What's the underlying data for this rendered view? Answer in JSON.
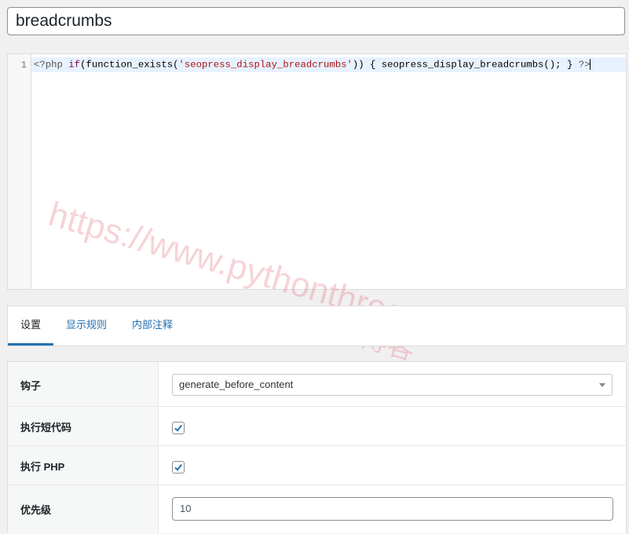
{
  "title_value": "breadcrumbs",
  "editor": {
    "line_number": "1",
    "code": {
      "open_tag": "<?php",
      "kw_if": "if",
      "fn_exists": "(function_exists(",
      "string": "'seopress_display_breadcrumbs'",
      "after_string": ")) { seopress_display_breadcrumbs(); }",
      "close_tag": "?>"
    }
  },
  "watermark": {
    "url": "https://www.pythonthree.com",
    "name": "晓得博客"
  },
  "tabs": [
    {
      "label": "设置",
      "active": true
    },
    {
      "label": "显示规则",
      "active": false
    },
    {
      "label": "内部注释",
      "active": false
    }
  ],
  "settings": {
    "hook": {
      "label": "钩子",
      "value": "generate_before_content"
    },
    "shortcode": {
      "label": "执行短代码",
      "checked": true
    },
    "php": {
      "label": "执行 PHP",
      "checked": true
    },
    "priority": {
      "label": "优先级",
      "value": "10"
    }
  },
  "colors": {
    "accent": "#2271b1",
    "background": "#f0f0f1"
  }
}
